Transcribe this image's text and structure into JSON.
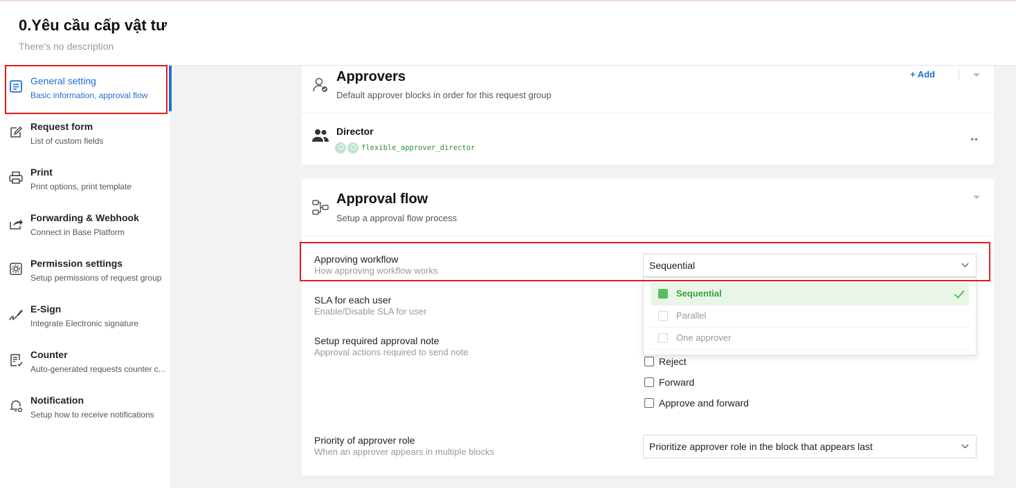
{
  "header": {
    "title": "0.Yêu cầu cấp vật tư",
    "description": "There's no description"
  },
  "sidebar": {
    "items": [
      {
        "label": "General setting",
        "sub": "Basic information, approval flow",
        "icon": "document-icon",
        "active": true
      },
      {
        "label": "Request form",
        "sub": "List of custom fields",
        "icon": "edit-icon"
      },
      {
        "label": "Print",
        "sub": "Print options, print template",
        "icon": "printer-icon"
      },
      {
        "label": "Forwarding & Webhook",
        "sub": "Connect in Base Platform",
        "icon": "share-icon"
      },
      {
        "label": "Permission settings",
        "sub": "Setup permissions of request group",
        "icon": "gear-box-icon"
      },
      {
        "label": "E-Sign",
        "sub": "Integrate Electronic signature",
        "icon": "signature-icon"
      },
      {
        "label": "Counter",
        "sub": "Auto-generated requests counter c...",
        "icon": "counter-icon"
      },
      {
        "label": "Notification",
        "sub": "Setup how to receive notifications",
        "icon": "bell-gear-icon"
      }
    ]
  },
  "approvers": {
    "title": "Approvers",
    "subtitle": "Default approver blocks in order for this request group",
    "add_label": "+ Add",
    "block": {
      "name": "Director",
      "code": "flexible_approver_director",
      "more": "••"
    }
  },
  "approval_flow": {
    "title": "Approval flow",
    "subtitle": "Setup a approval flow process",
    "workflow": {
      "label": "Approving workflow",
      "sub": "How approving workflow works",
      "value": "Sequential",
      "options": [
        {
          "label": "Sequential",
          "selected": true
        },
        {
          "label": "Parallel",
          "selected": false
        },
        {
          "label": "One approver",
          "selected": false
        }
      ]
    },
    "sla": {
      "label": "SLA for each user",
      "sub": "Enable/Disable SLA for user"
    },
    "note": {
      "label": "Setup required approval note",
      "sub": "Approval actions required to send note",
      "checkboxes": [
        {
          "label": "Reject",
          "checked": false
        },
        {
          "label": "Forward",
          "checked": false
        },
        {
          "label": "Approve and forward",
          "checked": false
        }
      ]
    },
    "priority": {
      "label": "Priority of approver role",
      "sub": "When an approver appears in multiple blocks",
      "value": "Prioritize approver role in the block that appears last"
    }
  },
  "colors": {
    "accent": "#1f6ed4",
    "highlight": "#e01b1b",
    "success": "#5bbd5a"
  }
}
